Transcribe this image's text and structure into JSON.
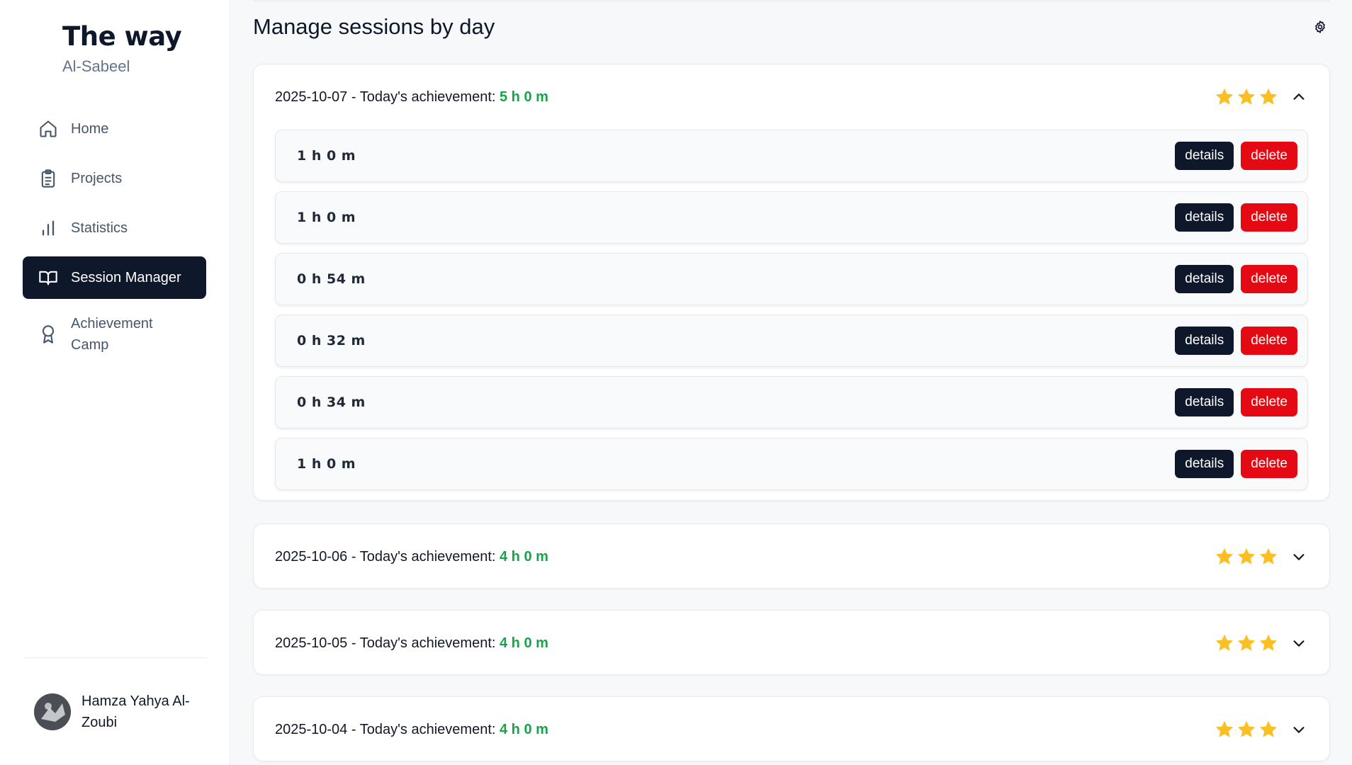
{
  "brand": {
    "title": "The way",
    "subtitle": "Al-Sabeel"
  },
  "nav": {
    "items": [
      {
        "label": "Home",
        "icon": "home-icon",
        "active": false
      },
      {
        "label": "Projects",
        "icon": "clipboard-icon",
        "active": false
      },
      {
        "label": "Statistics",
        "icon": "bar-chart-icon",
        "active": false
      },
      {
        "label": "Session Manager",
        "icon": "book-open-icon",
        "active": true
      },
      {
        "label": "Achievement Camp",
        "icon": "award-icon",
        "active": false
      }
    ]
  },
  "user": {
    "name": "Hamza Yahya Al-Zoubi"
  },
  "main": {
    "title": "Manage sessions by day",
    "settings_icon": "gear-icon",
    "achievement_label": "Today's achievement:",
    "details_label": "details",
    "delete_label": "delete",
    "days": [
      {
        "date": "2025-10-07",
        "achievement": "5 h 0 m",
        "stars": 3,
        "expanded": true,
        "sessions": [
          "1 h 0 m",
          "1 h 0 m",
          "0 h 54 m",
          "0 h 32 m",
          "0 h 34 m",
          "1 h 0 m"
        ]
      },
      {
        "date": "2025-10-06",
        "achievement": "4 h 0 m",
        "stars": 3,
        "expanded": false,
        "sessions": []
      },
      {
        "date": "2025-10-05",
        "achievement": "4 h 0 m",
        "stars": 3,
        "expanded": false,
        "sessions": []
      },
      {
        "date": "2025-10-04",
        "achievement": "4 h 0 m",
        "stars": 3,
        "expanded": false,
        "sessions": []
      }
    ]
  },
  "colors": {
    "primary": "#0f172a",
    "danger": "#e50914",
    "success": "#16a34a",
    "star": "#fbbf24"
  }
}
